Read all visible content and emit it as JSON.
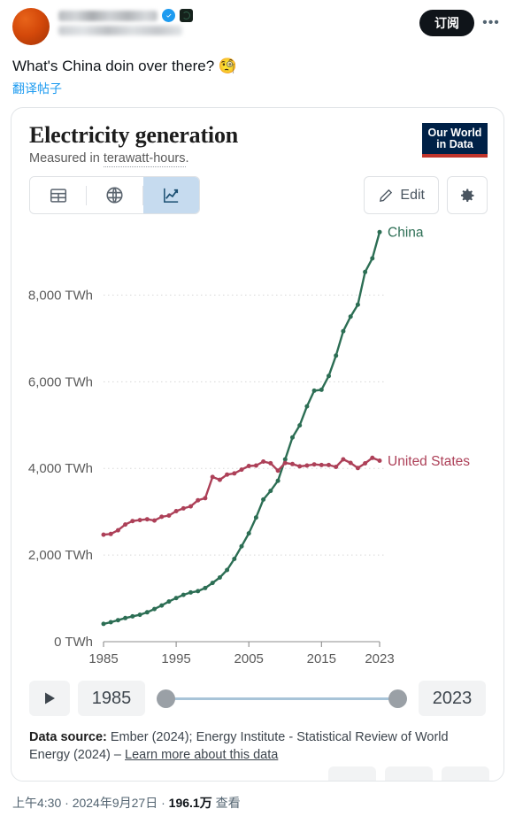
{
  "tweet": {
    "subscribe_label": "订阅",
    "more_label": "•••",
    "text": "What's China doin over there? ",
    "emoji": "🧐",
    "translate_label": "翻译帖子",
    "meta_time": "上午4:30",
    "meta_sep1": " · ",
    "meta_date": "2024年9月27日",
    "meta_sep2": " · ",
    "meta_views_count": "196.1万",
    "meta_views_label": " 查看"
  },
  "chart": {
    "title": "Electricity generation",
    "subtitle_prefix": "Measured in ",
    "subtitle_underlined": "terawatt-hours",
    "subtitle_suffix": ".",
    "logo_line1": "Our World",
    "logo_line2": "in Data",
    "tabs": [
      {
        "name": "table",
        "label": "Table",
        "active": false
      },
      {
        "name": "map",
        "label": "Map",
        "active": false
      },
      {
        "name": "chart",
        "label": "Chart",
        "active": true
      }
    ],
    "edit_label": "Edit",
    "settings_label": "Settings",
    "slider": {
      "play_label": "Play",
      "start_year": "1985",
      "end_year": "2023"
    },
    "source": {
      "prefix": "Data source:",
      "body": " Ember (2024); Energy Institute - Statistical Review of World Energy (2024) – ",
      "link": "Learn more about this data"
    }
  },
  "colors": {
    "china": "#2c6e54",
    "united_states": "#ad4058",
    "accent_blue": "#1d9bf0",
    "tab_active_bg": "#c6dbef",
    "owid_navy": "#002147",
    "owid_red": "#c0342b"
  },
  "chart_data": {
    "type": "line",
    "title": "Electricity generation",
    "subtitle": "Measured in terawatt-hours.",
    "xlabel": "",
    "ylabel": "TWh",
    "xlim": [
      1985,
      2023
    ],
    "ylim": [
      0,
      9500
    ],
    "grid": true,
    "legend_position": "right-of-line-end",
    "x_tick_labels": [
      "1985",
      "1995",
      "2005",
      "2015",
      "2023"
    ],
    "x_ticks": [
      1985,
      1995,
      2005,
      2015,
      2023
    ],
    "y_tick_labels": [
      "0 TWh",
      "2,000 TWh",
      "4,000 TWh",
      "6,000 TWh",
      "8,000 TWh"
    ],
    "y_ticks": [
      0,
      2000,
      4000,
      6000,
      8000
    ],
    "x": [
      1985,
      1986,
      1987,
      1988,
      1989,
      1990,
      1991,
      1992,
      1993,
      1994,
      1995,
      1996,
      1997,
      1998,
      1999,
      2000,
      2001,
      2002,
      2003,
      2004,
      2005,
      2006,
      2007,
      2008,
      2009,
      2010,
      2011,
      2012,
      2013,
      2014,
      2015,
      2016,
      2017,
      2018,
      2019,
      2020,
      2021,
      2022,
      2023
    ],
    "series": [
      {
        "name": "China",
        "color": "#2c6e54",
        "label_x": 2023,
        "values": [
          411,
          450,
          497,
          545,
          585,
          621,
          678,
          754,
          836,
          928,
          1007,
          1081,
          1136,
          1167,
          1239,
          1356,
          1481,
          1654,
          1911,
          2203,
          2500,
          2866,
          3282,
          3482,
          3715,
          4208,
          4715,
          4994,
          5432,
          5794,
          5815,
          6133,
          6604,
          7166,
          7503,
          7779,
          8534,
          8849,
          9456
        ]
      },
      {
        "name": "United States",
        "color": "#ad4058",
        "label_x": 2023,
        "values": [
          2470,
          2487,
          2572,
          2704,
          2784,
          2808,
          2825,
          2797,
          2883,
          2911,
          3013,
          3077,
          3123,
          3264,
          3311,
          3802,
          3737,
          3858,
          3883,
          3971,
          4055,
          4065,
          4157,
          4119,
          3950,
          4125,
          4100,
          4048,
          4066,
          4093,
          4078,
          4077,
          4034,
          4208,
          4127,
          4009,
          4116,
          4243,
          4178
        ]
      }
    ]
  }
}
